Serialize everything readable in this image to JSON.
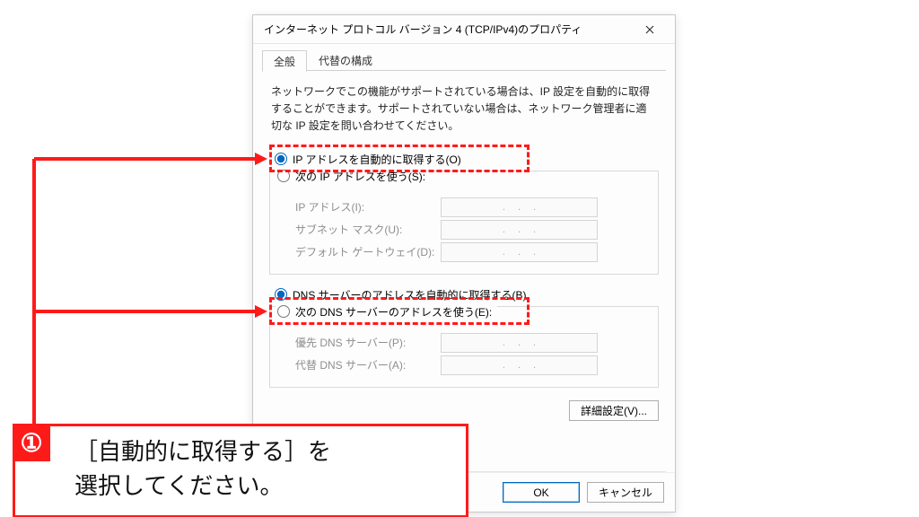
{
  "dialog": {
    "title": "インターネット プロトコル バージョン 4 (TCP/IPv4)のプロパティ",
    "tabs": {
      "general": "全般",
      "alt": "代替の構成"
    },
    "description": "ネットワークでこの機能がサポートされている場合は、IP 設定を自動的に取得することができます。サポートされていない場合は、ネットワーク管理者に適切な IP 設定を問い合わせてください。",
    "ip_auto_label": "IP アドレスを自動的に取得する(O)",
    "ip_manual_label": "次の IP アドレスを使う(S):",
    "ip_address_label": "IP アドレス(I):",
    "subnet_label": "サブネット マスク(U):",
    "gateway_label": "デフォルト ゲートウェイ(D):",
    "dns_auto_label": "DNS サーバーのアドレスを自動的に取得する(B)",
    "dns_manual_label": "次の DNS サーバーのアドレスを使う(E):",
    "dns_pref_label": "優先 DNS サーバー(P):",
    "dns_alt_label": "代替 DNS サーバー(A):",
    "ip_dots": "...",
    "adv_button": "詳細設定(V)...",
    "ok_button": "OK",
    "cancel_button": "キャンセル"
  },
  "annotation": {
    "step_number": "①",
    "text": "［自動的に取得する］を\n選択してください。"
  }
}
